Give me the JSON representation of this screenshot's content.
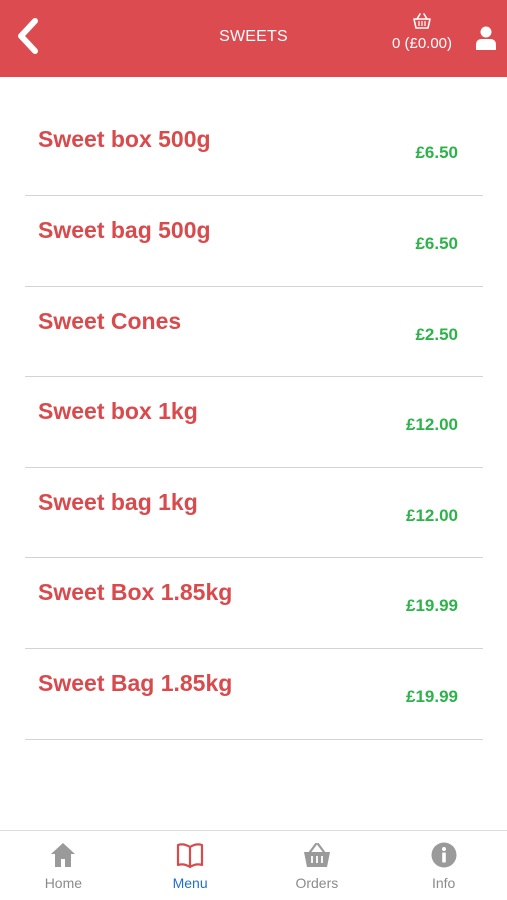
{
  "header": {
    "title": "SWEETS",
    "basket_label": "0 (£0.00)",
    "back_icon": "chevron-left-icon",
    "basket_icon": "basket-icon",
    "user_icon": "user-icon",
    "bg_color": "#dc4b4f"
  },
  "items": [
    {
      "name": "Sweet box 500g",
      "price": "£6.50"
    },
    {
      "name": "Sweet bag 500g",
      "price": "£6.50"
    },
    {
      "name": "Sweet Cones",
      "price": "£2.50"
    },
    {
      "name": "Sweet box 1kg",
      "price": "£12.00"
    },
    {
      "name": "Sweet bag 1kg",
      "price": "£12.00"
    },
    {
      "name": "Sweet Box 1.85kg",
      "price": "£19.99"
    },
    {
      "name": "Sweet Bag 1.85kg",
      "price": "£19.99"
    }
  ],
  "nav": {
    "items": [
      {
        "label": "Home",
        "icon": "home-icon"
      },
      {
        "label": "Menu",
        "icon": "book-icon",
        "active": true
      },
      {
        "label": "Orders",
        "icon": "basket-icon"
      },
      {
        "label": "Info",
        "icon": "info-icon"
      }
    ]
  },
  "colors": {
    "item_name": "#d94a4d",
    "price": "#2db34a",
    "active_nav": "#1f6fd0",
    "inactive_nav": "#8b8b8b"
  }
}
